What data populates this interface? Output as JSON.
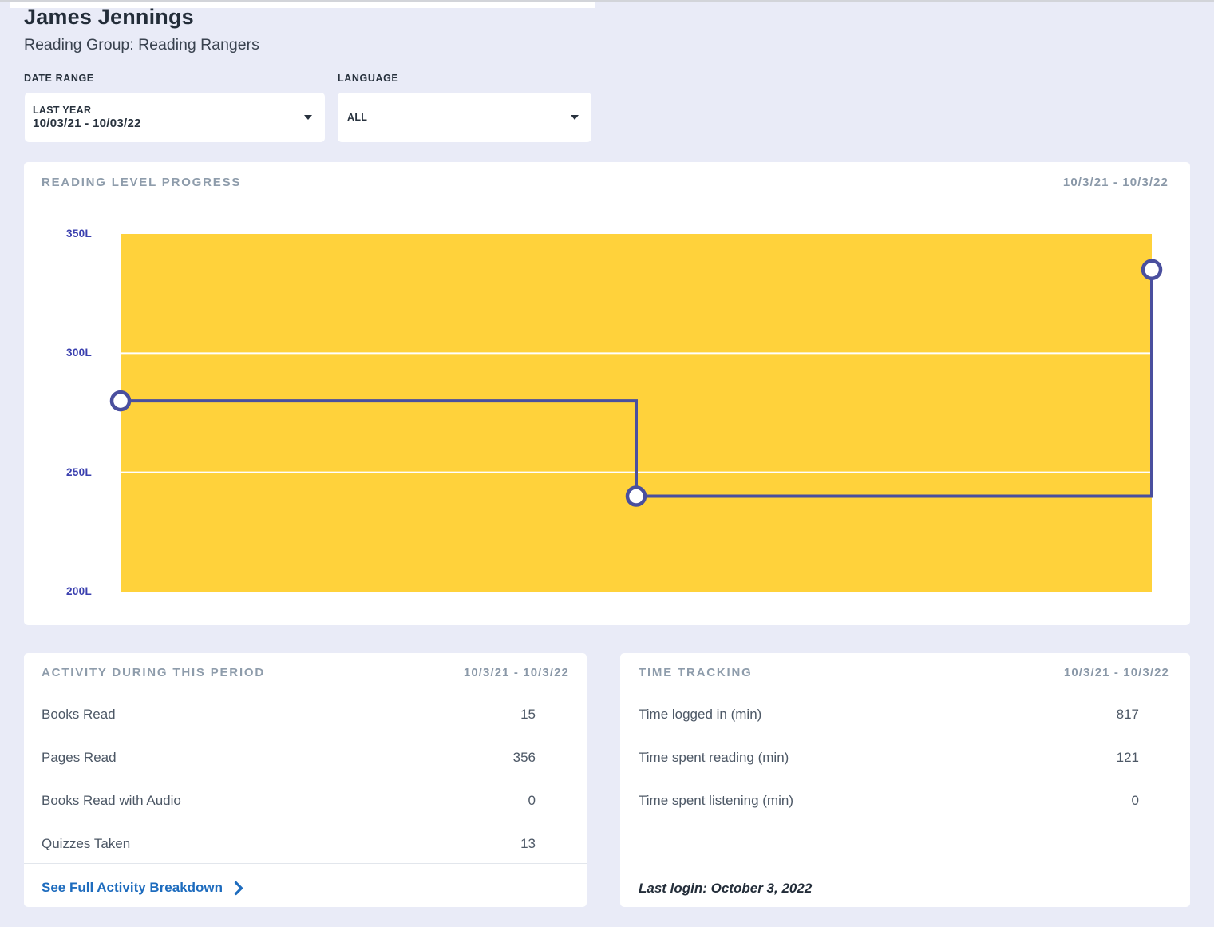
{
  "header": {
    "student_name": "James Jennings",
    "reading_group": "Reading Group: Reading Rangers"
  },
  "filters": {
    "date_range": {
      "label": "DATE RANGE",
      "selected_preset": "LAST YEAR",
      "selected_dates": "10/03/21 - 10/03/22"
    },
    "language": {
      "label": "LANGUAGE",
      "selected": "ALL"
    }
  },
  "chart_card": {
    "title": "READING LEVEL PROGRESS",
    "date_range": "10/3/21 - 10/3/22"
  },
  "chart_data": {
    "type": "line",
    "step": "horizontal-then-vertical",
    "title": "READING LEVEL PROGRESS",
    "date_start": "10/3/21",
    "date_end": "10/3/22",
    "unit": "Lexile",
    "x_fraction": [
      0,
      0.5,
      1
    ],
    "values": [
      280,
      240,
      335
    ],
    "ylim": [
      200,
      350
    ],
    "yticks": [
      350,
      300,
      250,
      200
    ],
    "ytick_labels": [
      "350L",
      "300L",
      "250L",
      "200L"
    ],
    "gridlines": [
      300,
      250
    ],
    "area_color": "#FFD23B",
    "grid_color": "#FFFFFF",
    "line_color": "#4A4F9E",
    "marker_fill": "#FFFFFF"
  },
  "activity_card": {
    "title": "ACTIVITY DURING THIS PERIOD",
    "date_range": "10/3/21 - 10/3/22",
    "rows": [
      {
        "label": "Books Read",
        "value": "15"
      },
      {
        "label": "Pages Read",
        "value": "356"
      },
      {
        "label": "Books Read with Audio",
        "value": "0"
      },
      {
        "label": "Quizzes Taken",
        "value": "13"
      }
    ],
    "link_label": "See Full Activity Breakdown"
  },
  "time_card": {
    "title": "TIME TRACKING",
    "date_range": "10/3/21 - 10/3/22",
    "rows": [
      {
        "label": "Time logged in (min)",
        "value": "817"
      },
      {
        "label": "Time spent reading (min)",
        "value": "121"
      },
      {
        "label": "Time spent listening (min)",
        "value": "0"
      }
    ],
    "last_login": "Last login: October 3, 2022"
  },
  "colors": {
    "page_background": "#E9EBF7",
    "card_background": "#FFFFFF",
    "accent_yellow": "#FFD23B",
    "accent_indigo": "#4A4F9E",
    "axis_label_indigo": "#3B40AF",
    "link_blue": "#1E6CBE",
    "section_title_grey": "#8E9CAB",
    "text_dark": "#232D39",
    "row_text": "#4D5866"
  }
}
